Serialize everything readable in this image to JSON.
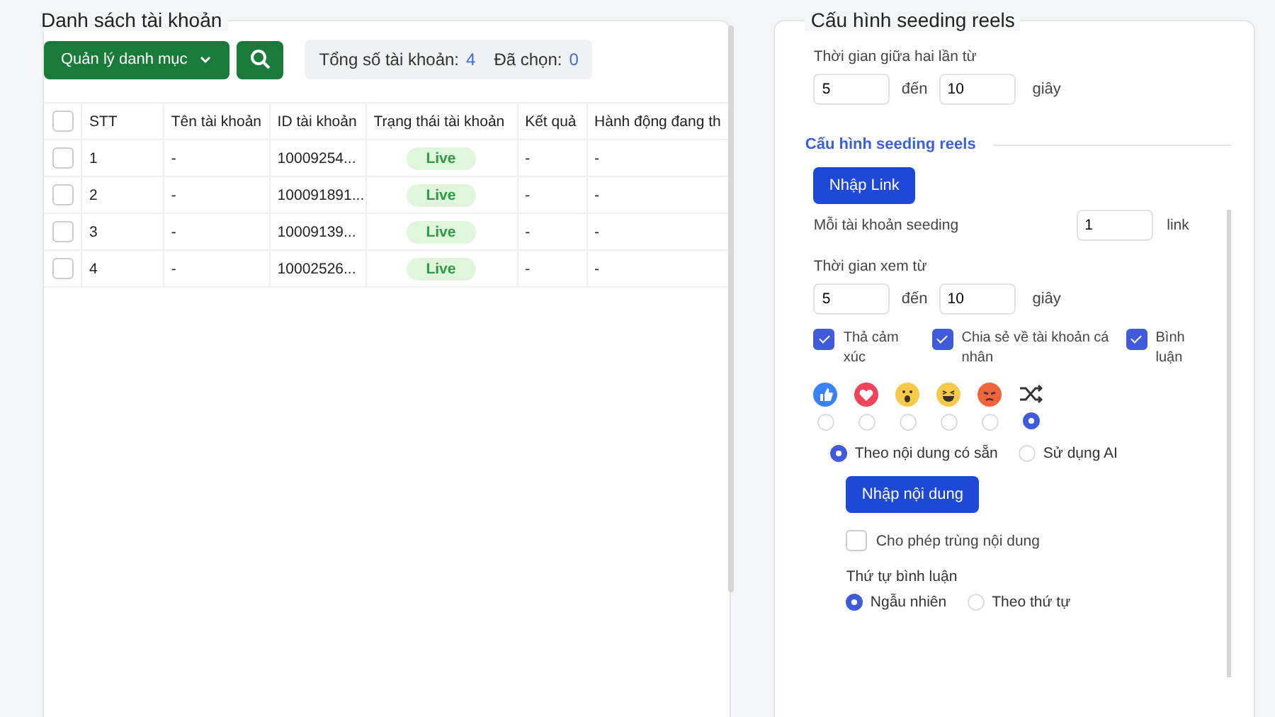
{
  "accounts_panel": {
    "title": "Danh sách tài khoản",
    "category_button": "Quản lý danh mục",
    "total_label": "Tổng số tài khoản:",
    "total": "4",
    "selected_label": "Đã chọn:",
    "selected_count": "0"
  },
  "table": {
    "all_checked": false,
    "columns": [
      "STT",
      "Tên tài khoản",
      "ID tài khoản",
      "Trạng thái tài khoản",
      "Kết quả",
      "Hành động đang th"
    ],
    "rows": [
      {
        "checked": false,
        "cells": [
          "1",
          "-",
          "10009254...",
          "Live",
          "-",
          "-"
        ]
      },
      {
        "checked": false,
        "cells": [
          "2",
          "-",
          "100091891...",
          "Live",
          "-",
          "-"
        ]
      },
      {
        "checked": false,
        "cells": [
          "3",
          "-",
          "10009139...",
          "Live",
          "-",
          "-"
        ]
      },
      {
        "checked": false,
        "cells": [
          "4",
          "-",
          "10002526...",
          "Live",
          "-",
          "-"
        ]
      }
    ]
  },
  "config": {
    "title": "Cấu hình seeding reels",
    "interval_label": "Thời gian giữa hai lần từ",
    "interval_from": "5",
    "interval_to_label": "đến",
    "interval_to": "10",
    "interval_unit": "giây",
    "section_title": "Cấu hình seeding reels",
    "link_button": "Nhập Link",
    "per_account_label": "Mỗi tài khoản seeding",
    "per_account": "1",
    "per_account_unit": "link",
    "watch_label": "Thời gian xem từ",
    "watch_from": "5",
    "watch_to_label": "đến",
    "watch_to": "10",
    "watch_unit": "giây",
    "actions": [
      {
        "label": "Thả cảm xúc",
        "checked": true
      },
      {
        "label": "Chia sẻ về tài khoản cá nhân",
        "checked": true
      },
      {
        "label": "Bình luận",
        "checked": true
      }
    ],
    "reactions": [
      {
        "kind": "like",
        "selected": false
      },
      {
        "kind": "love",
        "selected": false
      },
      {
        "kind": "wow",
        "selected": false
      },
      {
        "kind": "haha",
        "selected": false
      },
      {
        "kind": "angry",
        "selected": false
      },
      {
        "kind": "random",
        "selected": true
      }
    ],
    "content_sources": [
      {
        "label": "Theo nội dung có sẵn",
        "selected": true
      },
      {
        "label": "Sử dụng AI",
        "selected": false
      }
    ],
    "content_button": "Nhập nội dung",
    "allow_duplicate": {
      "label": "Cho phép trùng nội dung",
      "checked": false
    },
    "order_label": "Thứ tự bình luận",
    "orders": [
      {
        "label": "Ngẫu nhiên",
        "selected": true
      },
      {
        "label": "Theo thứ tự",
        "selected": false
      }
    ]
  }
}
